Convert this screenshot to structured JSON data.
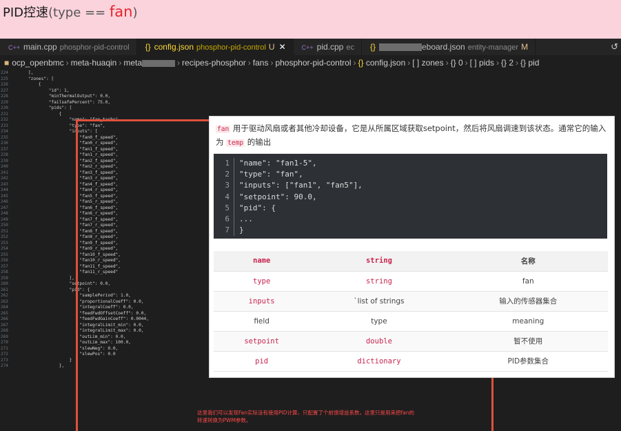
{
  "title": {
    "prefix": "PID控速",
    "type_part": "(type == ",
    "fan": "fan",
    "close": ")"
  },
  "tabs": [
    {
      "icon": "C++",
      "name": "main.cpp",
      "sub": "phosphor-pid-control"
    },
    {
      "icon": "{}",
      "name": "config.json",
      "sub": "phosphor-pid-control",
      "mod": "U",
      "close": "✕"
    },
    {
      "icon": "C++",
      "name": "pid.cpp",
      "sub": "ec"
    },
    {
      "icon": "{}",
      "name": "eboard.json",
      "sub": "entity-manager",
      "mod": "M"
    }
  ],
  "history_icon": "↺",
  "breadcrumb": [
    "ocp_openbmc",
    "meta-huaqin",
    "meta",
    "recipes-phosphor",
    "fans",
    "phosphor-pid-control",
    "config.json",
    "[ ] zones",
    "{} 0",
    "[ ] pids",
    "{} 2",
    "{} pid"
  ],
  "line_numbers": [
    "224",
    "225",
    "226",
    "227",
    "228",
    "229",
    "230",
    "231",
    "232",
    "233",
    "234",
    "235",
    "236",
    "237",
    "238",
    "239",
    "240",
    "241",
    "242",
    "243",
    "244",
    "245",
    "246",
    "247",
    "248",
    "249",
    "250",
    "251",
    "252",
    "253",
    "254",
    "255",
    "256",
    "257",
    "258",
    "259",
    "260",
    "261",
    "262",
    "263",
    "264",
    "265",
    "266",
    "267",
    "268",
    "269",
    "270",
    "271",
    "272",
    "273",
    "274"
  ],
  "code_lines": [
    "    ],",
    "    \"zones\": [",
    "        {",
    "            \"id\": 1,",
    "            \"minThermalOutput\": 0.0,",
    "            \"failsafePercent\": 75.0,",
    "            \"pids\": [",
    "                {",
    "                    \"name\": \"fan_tachs\",",
    "                    \"type\": \"fan\",",
    "                    \"inputs\": [",
    "                        \"fan0_f_speed\",",
    "                        \"fan0_r_speed\",",
    "                        \"fan1_f_speed\",",
    "                        \"fan1_r_speed\",",
    "                        \"fan2_f_speed\",",
    "                        \"fan2_r_speed\",",
    "                        \"fan3_f_speed\",",
    "                        \"fan3_r_speed\",",
    "                        \"fan4_f_speed\",",
    "                        \"fan4_r_speed\",",
    "                        \"fan5_f_speed\",",
    "                        \"fan5_r_speed\",",
    "                        \"fan6_f_speed\",",
    "                        \"fan6_r_speed\",",
    "                        \"fan7_f_speed\",",
    "                        \"fan7_r_speed\",",
    "                        \"fan8_f_speed\",",
    "                        \"fan8_r_speed\",",
    "                        \"fan9_f_speed\",",
    "                        \"fan9_r_speed\",",
    "                        \"fan10_f_speed\",",
    "                        \"fan10_r_speed\",",
    "                        \"fan11_f_speed\",",
    "                        \"fan11_r_speed\"",
    "                    ],",
    "                    \"setpoint\": 0.0,",
    "                    \"pid\": {",
    "                        \"samplePeriod\": 1.0,",
    "                        \"proportionalCoeff\": 0.0,",
    "                        \"integralCoeff\": 0.0,",
    "                        \"feedFwdOffsetCoeff\": 0.0,",
    "                        \"feedFwdGainCoeff\": 0.0044,",
    "                        \"integralLimit_min\": 0.0,",
    "                        \"integralLimit_max\": 0.0,",
    "                        \"outLim_min\": 0.0,",
    "                        \"outLim_max\": 100.0,",
    "                        \"slewNeg\": 0.0,",
    "                        \"slewPos\": 0.0",
    "                    }",
    "                },"
  ],
  "annotation": "这里我们可以发现Fan实际没有使用PID计算，只配置了个前馈增益系数，这里只是用来把fan的转速转换为PWM参数。",
  "panel": {
    "desc_code1": "fan",
    "desc_text1": " 用于驱动风扇或者其他冷却设备，它是从所属区域获取setpoint，然后将风扇调速到该状态。通常它的输入为 ",
    "desc_code2": "temp",
    "desc_text2": " 的输出",
    "code_block": [
      {
        "ln": "1",
        "text": "\"name\": \"fan1-5\","
      },
      {
        "ln": "2",
        "text": "\"type\": \"fan\","
      },
      {
        "ln": "3",
        "text": "\"inputs\": [\"fan1\", \"fan5\"],"
      },
      {
        "ln": "4",
        "text": "\"setpoint\": 90.0,"
      },
      {
        "ln": "5",
        "text": "\"pid\": {"
      },
      {
        "ln": "6",
        "text": "..."
      },
      {
        "ln": "7",
        "text": "}"
      }
    ],
    "table": {
      "header": [
        "name",
        "string",
        "名称"
      ],
      "rows": [
        [
          "type",
          "string",
          "fan"
        ],
        [
          "inputs",
          "`list of strings",
          "输入的传感器集合"
        ],
        [
          "field",
          "type",
          "meaning"
        ],
        [
          "setpoint",
          "double",
          "暂不使用"
        ],
        [
          "pid",
          "dictionary",
          "PID参数集合"
        ]
      ]
    }
  },
  "colors": {
    "background": "#fad3dc",
    "editor": "#1e1e1e",
    "accent_red": "#e0503c",
    "active_tab": "#fdd835"
  }
}
